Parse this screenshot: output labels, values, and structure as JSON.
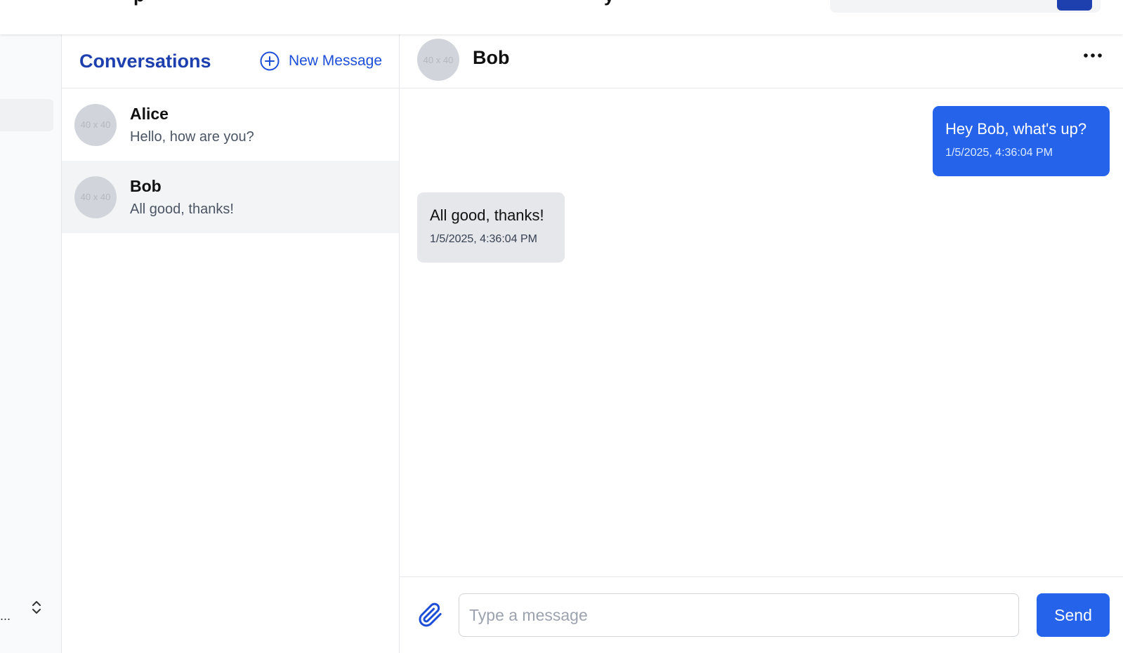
{
  "conversations": {
    "title": "Conversations",
    "new_message_label": "New Message",
    "items": [
      {
        "name": "Alice",
        "preview": "Hello, how are you?",
        "avatar_text": "40 x 40"
      },
      {
        "name": "Bob",
        "preview": "All good, thanks!",
        "avatar_text": "40 x 40"
      }
    ]
  },
  "chat": {
    "contact_name": "Bob",
    "avatar_text": "40 x 40",
    "messages": [
      {
        "direction": "outgoing",
        "text": "Hey Bob, what's up?",
        "time": "1/5/2025, 4:36:04 PM"
      },
      {
        "direction": "incoming",
        "text": "All good, thanks!",
        "time": "1/5/2025, 4:36:04 PM"
      }
    ],
    "input_placeholder": "Type a message",
    "send_label": "Send"
  },
  "sidebar": {
    "truncated_label": "..."
  },
  "colors": {
    "accent": "#2563eb",
    "title_blue": "#1e40af",
    "incoming_bubble": "#e5e7eb",
    "active_row": "#f3f4f6"
  },
  "icons": [
    "plus-circle-icon",
    "more-horizontal-icon",
    "paperclip-icon",
    "chevron-up-down-icon",
    "search-icon"
  ]
}
